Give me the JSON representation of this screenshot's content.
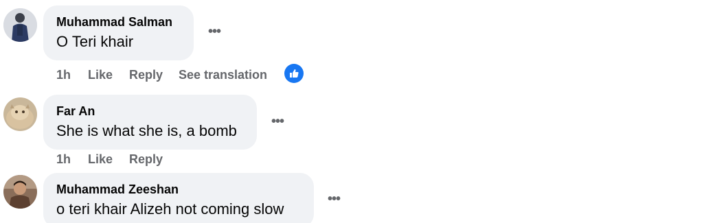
{
  "comments": [
    {
      "author": "Muhammad Salman",
      "text": "O Teri khair",
      "time": "1h",
      "like_label": "Like",
      "reply_label": "Reply",
      "translate_label": "See translation",
      "more_icon": "more-horizontal-icon",
      "reaction_icon": "thumbs-up-icon",
      "reaction_color": "#1877f2"
    },
    {
      "author": "Far An",
      "text": "She is what she is, a bomb",
      "time": "1h",
      "like_label": "Like",
      "reply_label": "Reply",
      "more_icon": "more-horizontal-icon"
    },
    {
      "author": "Muhammad Zeeshan",
      "text": "o teri khair Alizeh not coming slow",
      "more_icon": "more-horizontal-icon"
    }
  ],
  "colors": {
    "bubble_bg": "#f0f2f5",
    "secondary_text": "#65676b",
    "primary_text": "#050505",
    "accent": "#1877f2"
  }
}
